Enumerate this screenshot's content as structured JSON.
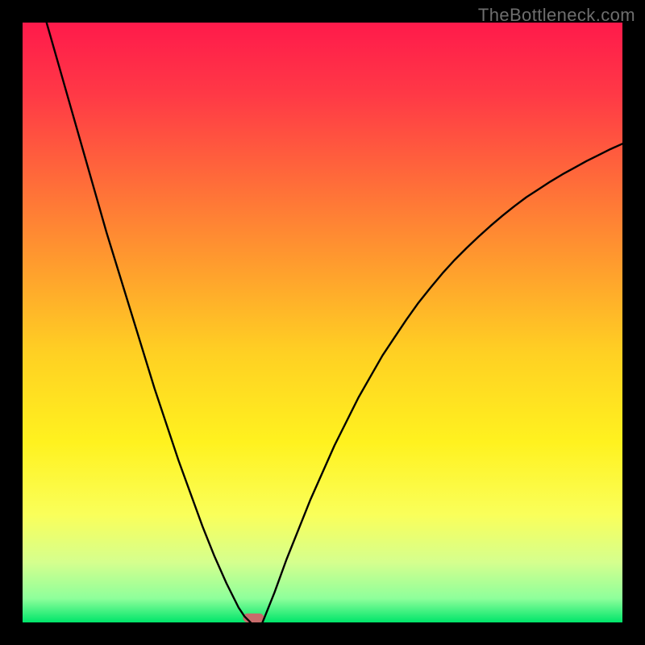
{
  "watermark": "TheBottleneck.com",
  "chart_data": {
    "type": "line",
    "title": "",
    "xlabel": "",
    "ylabel": "",
    "xlim": [
      0,
      100
    ],
    "ylim": [
      0,
      100
    ],
    "legend": false,
    "grid": false,
    "background_gradient_top": "#ff1a4b",
    "background_gradient_bottom": "#00e56a",
    "series": [
      {
        "name": "left-curve",
        "x": [
          4,
          6,
          8,
          10,
          12,
          14,
          16,
          18,
          20,
          22,
          24,
          26,
          28,
          30,
          32,
          34,
          36,
          37,
          38
        ],
        "values": [
          100,
          93,
          86,
          79,
          72,
          65,
          58.5,
          52,
          45.5,
          39,
          33,
          27,
          21.5,
          16,
          11,
          6.5,
          2.5,
          1,
          0
        ]
      },
      {
        "name": "right-curve",
        "x": [
          40,
          42,
          44,
          46,
          48,
          50,
          52,
          54,
          56,
          58,
          60,
          62,
          64,
          66,
          68,
          70,
          72,
          74,
          76,
          78,
          80,
          82,
          84,
          86,
          88,
          90,
          92,
          94,
          96,
          98,
          100
        ],
        "values": [
          0,
          5,
          10.5,
          15.5,
          20.5,
          25,
          29.5,
          33.5,
          37.5,
          41,
          44.5,
          47.5,
          50.5,
          53.3,
          55.8,
          58.2,
          60.4,
          62.4,
          64.3,
          66.1,
          67.8,
          69.4,
          70.9,
          72.2,
          73.5,
          74.7,
          75.8,
          76.9,
          77.9,
          78.9,
          79.8
        ]
      }
    ],
    "optimal_marker": {
      "x": 38.5,
      "y": 0,
      "width": 3.5,
      "height": 1.5,
      "color": "#c76b6b"
    },
    "gradient_stops": [
      {
        "offset": 0.0,
        "color": "#ff1a4b"
      },
      {
        "offset": 0.12,
        "color": "#ff3946"
      },
      {
        "offset": 0.26,
        "color": "#ff6a3a"
      },
      {
        "offset": 0.4,
        "color": "#ff9b2e"
      },
      {
        "offset": 0.55,
        "color": "#ffd023"
      },
      {
        "offset": 0.7,
        "color": "#fff21f"
      },
      {
        "offset": 0.82,
        "color": "#faff5a"
      },
      {
        "offset": 0.9,
        "color": "#d5ff8e"
      },
      {
        "offset": 0.96,
        "color": "#8eff9b"
      },
      {
        "offset": 1.0,
        "color": "#00e56a"
      }
    ]
  }
}
